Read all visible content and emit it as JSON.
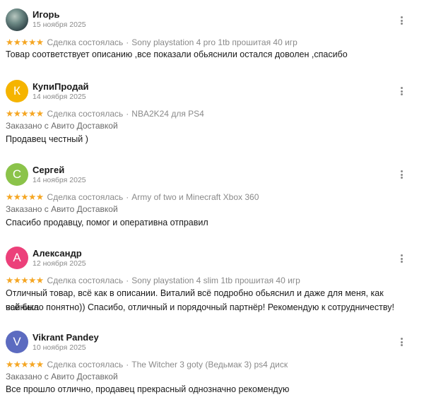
{
  "reviews": [
    {
      "avatar_letter": "",
      "avatar_color": "",
      "name": "Игорь",
      "date": "15 ноября 2025",
      "stars": "★★★★★",
      "deal": "Сделка состоялась",
      "item": "Sony playstation 4 pro 1tb прошитая 40 игр",
      "delivery": "",
      "text": "Товар соответствует описанию ,все показали обьяснили остался доволен ,спасибо"
    },
    {
      "avatar_letter": "К",
      "avatar_color": "#f5b400",
      "name": "КупиПродай",
      "date": "14 ноября 2025",
      "stars": "★★★★★",
      "deal": "Сделка состоялась",
      "item": "NBA2K24 для PS4",
      "delivery": "Заказано с Авито Доставкой",
      "text": "Продавец честный )"
    },
    {
      "avatar_letter": "С",
      "avatar_color": "#8bc34a",
      "name": "Сергей",
      "date": "14 ноября 2025",
      "stars": "★★★★★",
      "deal": "Сделка состоялась",
      "item": "Army of two и Minecraft Xbox 360",
      "delivery": "Заказано с Авито Доставкой",
      "text": "Спасибо продавцу, помог и оперативна отправил"
    },
    {
      "avatar_letter": "А",
      "avatar_color": "#ec407a",
      "name": "Александр",
      "date": "12 ноября 2025",
      "stars": "★★★★★",
      "deal": "Сделка состоялась",
      "item": "Sony playstation 4 slim 1tb прошитая 40 игр",
      "delivery": "",
      "text_line1": "Отличный товар, всё как в описании. Виталий всё подробно обьяснил и даже для меня, как чайника",
      "text_line2": "всё было понятно)) Спасибо, отличный и порядочный партнёр! Рекомендую к сотрудничеству!"
    },
    {
      "avatar_letter": "V",
      "avatar_color": "#5c6bc0",
      "name": "Vikrant Pandey",
      "date": "10 ноября 2025",
      "stars": "★★★★★",
      "deal": "Сделка состоялась",
      "item": "The Witcher 3 goty (Ведьмак 3) ps4 диск",
      "delivery": "Заказано с Авито Доставкой",
      "text": "Все прошло отлично, продавец прекрасный однозначно рекомендую"
    }
  ],
  "icons": {
    "more": "more-vertical-icon",
    "star": "star-icon"
  },
  "colors": {
    "star": "#f5a623",
    "muted": "#8a8a8a"
  }
}
